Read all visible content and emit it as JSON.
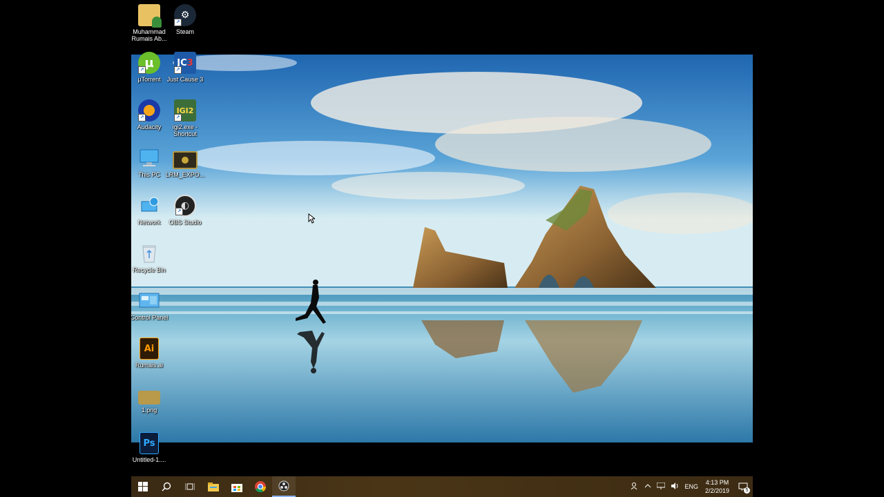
{
  "desktop_icons": [
    {
      "id": "user-folder",
      "label": "Muhammad Rumais Ab...",
      "icon": "user-folder-icon",
      "shortcut": false
    },
    {
      "id": "steam",
      "label": "Steam",
      "icon": "steam-icon",
      "shortcut": true
    },
    {
      "id": "utorrent",
      "label": "µTorrent",
      "icon": "utorrent-icon",
      "shortcut": true
    },
    {
      "id": "just-cause",
      "label": "Just Cause 3",
      "icon": "just-cause-3-icon",
      "shortcut": true
    },
    {
      "id": "audacity",
      "label": "Audacity",
      "icon": "audacity-icon",
      "shortcut": true
    },
    {
      "id": "igi2",
      "label": "igi2.exe - Shortcut",
      "icon": "igi2-icon",
      "shortcut": true
    },
    {
      "id": "this-pc",
      "label": "This PC",
      "icon": "computer-icon",
      "shortcut": false
    },
    {
      "id": "lrm",
      "label": "LRM_EXPO...",
      "icon": "video-file-icon",
      "shortcut": false
    },
    {
      "id": "network",
      "label": "Network",
      "icon": "network-icon",
      "shortcut": false
    },
    {
      "id": "obs",
      "label": "OBS Studio",
      "icon": "obs-icon",
      "shortcut": true
    },
    {
      "id": "recycle",
      "label": "Recycle Bin",
      "icon": "recycle-bin-icon",
      "shortcut": false
    },
    {
      "id": "control-panel",
      "label": "Control Panel",
      "icon": "control-panel-icon",
      "shortcut": false
    },
    {
      "id": "rumais-ai",
      "label": "Rumais.ai",
      "icon": "illustrator-file-icon",
      "shortcut": false
    },
    {
      "id": "png",
      "label": "1.png",
      "icon": "image-file-icon",
      "shortcut": false
    },
    {
      "id": "psd",
      "label": "Untitled-1....",
      "icon": "photoshop-file-icon",
      "shortcut": false
    }
  ],
  "taskbar": {
    "start_icon": "windows-start-icon",
    "search_icon": "search-icon",
    "taskview_icon": "task-view-icon",
    "pinned": [
      {
        "name": "file-explorer-icon"
      },
      {
        "name": "store-icon"
      },
      {
        "name": "chrome-icon"
      },
      {
        "name": "obs-taskbar-icon"
      }
    ]
  },
  "tray": {
    "language": "ENG",
    "time": "4:13 PM",
    "date": "2/2/2019",
    "notification_count": "5"
  },
  "colors": {
    "taskbar": "#3f2e14",
    "sky": "#4d9ad4"
  }
}
